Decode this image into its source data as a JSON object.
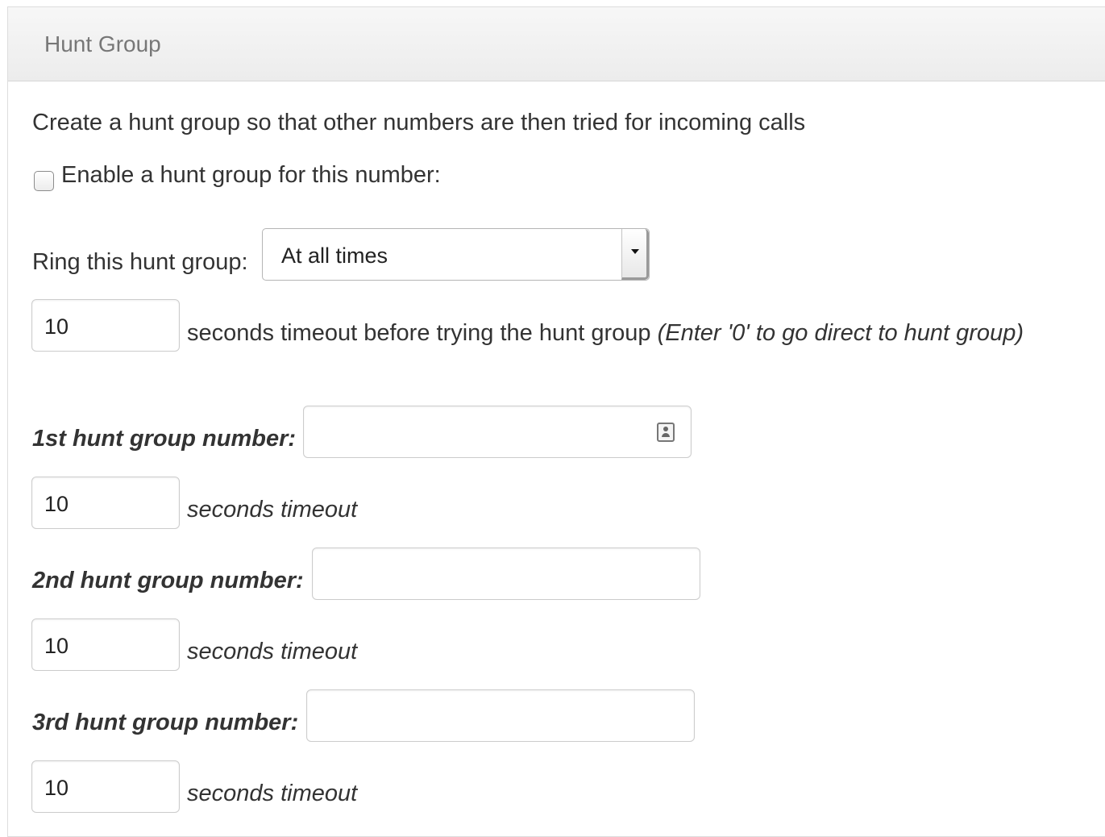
{
  "panel": {
    "title": "Hunt Group"
  },
  "description": "Create a hunt group so that other numbers are then tried for incoming calls",
  "enable": {
    "label": "Enable a hunt group for this number:",
    "checked": false
  },
  "ring": {
    "label": "Ring this hunt group:",
    "selected": "At all times"
  },
  "initial_timeout": {
    "value": "10",
    "label": "seconds timeout before trying the hunt group",
    "hint": "(Enter '0' to go direct to hunt group)"
  },
  "hunt_numbers": [
    {
      "label": "1st hunt group number:",
      "value": "",
      "has_contact_icon": true,
      "timeout_value": "10",
      "timeout_label": "seconds timeout"
    },
    {
      "label": "2nd hunt group number:",
      "value": "",
      "has_contact_icon": false,
      "timeout_value": "10",
      "timeout_label": "seconds timeout"
    },
    {
      "label": "3rd hunt group number:",
      "value": "",
      "has_contact_icon": false,
      "timeout_value": "10",
      "timeout_label": "seconds timeout"
    }
  ],
  "icons": {
    "contact": "contact-card-icon",
    "dropdown": "chevron-down-icon"
  },
  "colors": {
    "header_bg": "#f2f2f2",
    "border": "#cccccc",
    "text": "#333333",
    "title": "#777777"
  }
}
